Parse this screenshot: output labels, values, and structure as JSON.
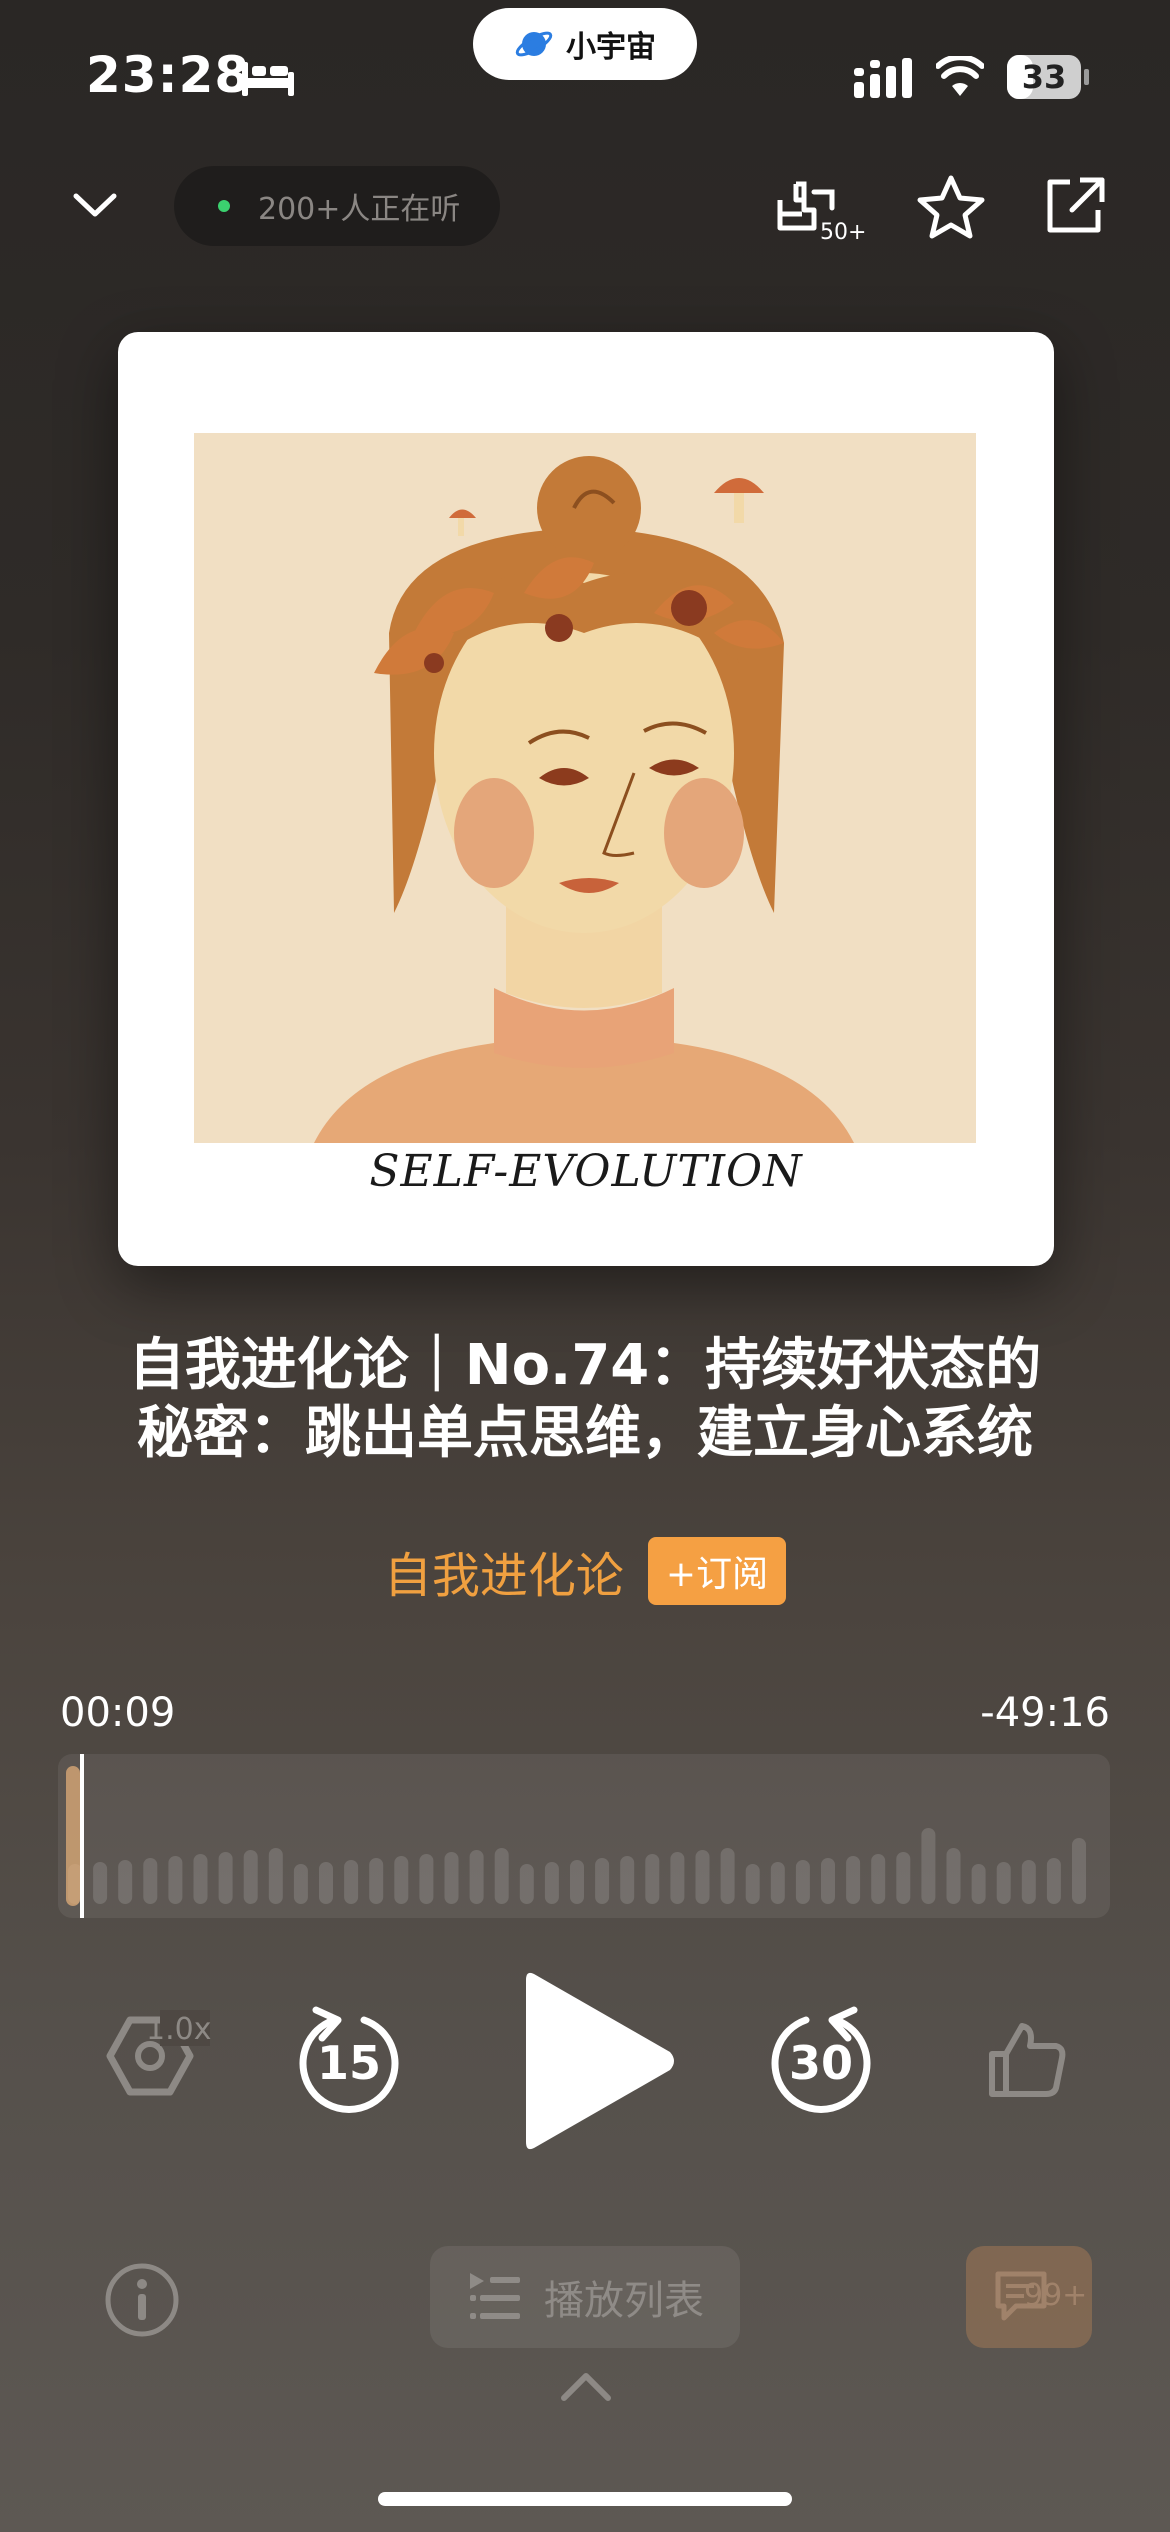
{
  "status_bar": {
    "time": "23:28",
    "app_name": "小宇宙",
    "battery": "33"
  },
  "top_bar": {
    "listening_text": "200+人正在听",
    "mark_count": "50+"
  },
  "cover": {
    "caption": "SELF-EVOLUTION"
  },
  "episode": {
    "title_line1": "自我进化论｜No.74：持续好状态的",
    "title_line2": "秘密：跳出单点思维，建立身心系统",
    "podcast_name": "自我进化论",
    "subscribe_label": "+订阅"
  },
  "player": {
    "elapsed": "00:09",
    "remaining": "-49:16",
    "speed": "1.0x",
    "back_seconds": "15",
    "forward_seconds": "30"
  },
  "bottom": {
    "playlist_label": "播放列表",
    "comment_count": "99+"
  },
  "colors": {
    "accent": "#f5a043",
    "podcast_name": "#f0a040",
    "online_dot": "#3bd16f"
  }
}
